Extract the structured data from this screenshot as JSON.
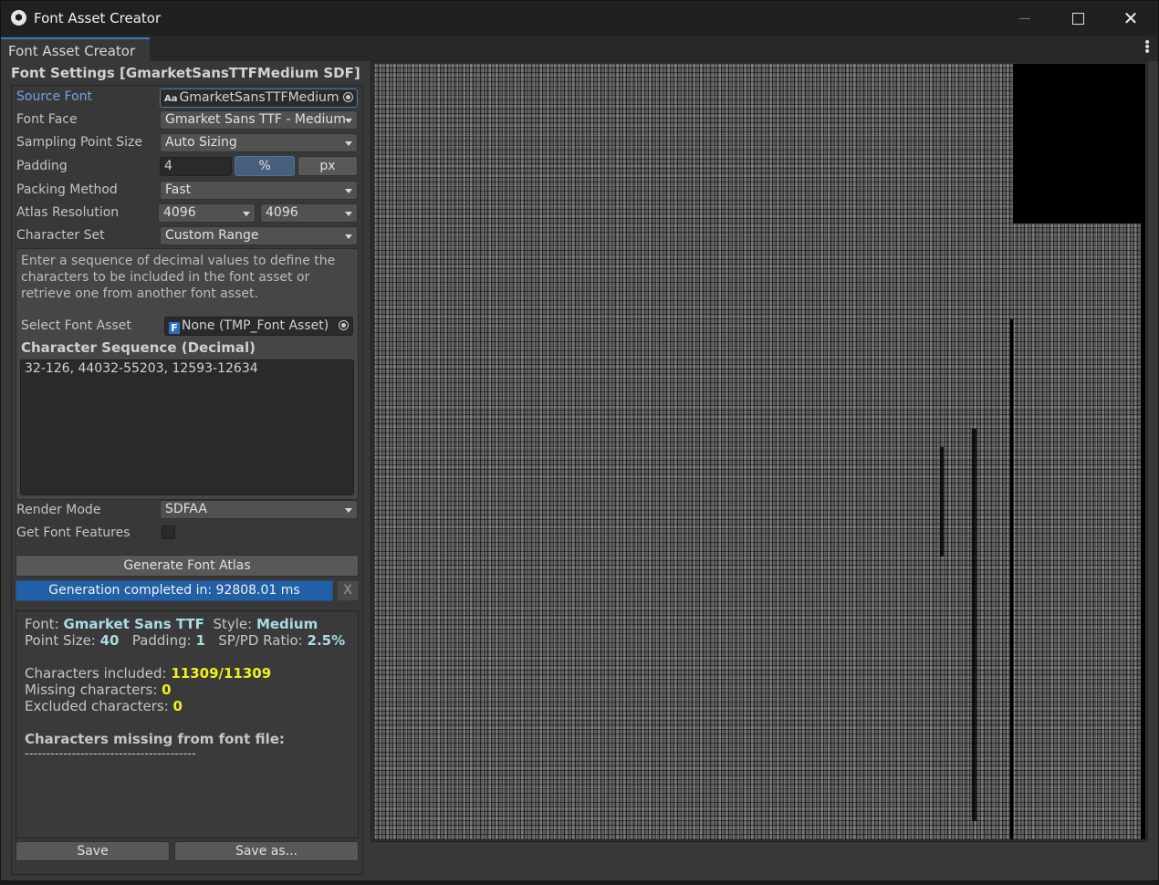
{
  "window": {
    "title": "Font Asset Creator"
  },
  "tabs": [
    {
      "label": "Font Asset Creator"
    }
  ],
  "settings": {
    "section_title": "Font Settings [GmarketSansTTFMedium SDF]",
    "source_font_label": "Source Font",
    "source_font_value": "GmarketSansTTFMedium",
    "source_font_icon_text": "Aa",
    "font_face_label": "Font Face",
    "font_face_value": "Gmarket Sans TTF - Medium",
    "sampling_label": "Sampling Point Size",
    "sampling_value": "Auto Sizing",
    "padding_label": "Padding",
    "padding_value": "4",
    "padding_percent": "%",
    "padding_px": "px",
    "packing_label": "Packing Method",
    "packing_value": "Fast",
    "atlas_label": "Atlas Resolution",
    "atlas_width": "4096",
    "atlas_height": "4096",
    "charset_label": "Character Set",
    "charset_value": "Custom Range",
    "help_text": "Enter a sequence of decimal values to define the characters to be included in the font asset or retrieve one from another font asset.",
    "select_font_asset_label": "Select Font Asset",
    "select_font_asset_value": "None (TMP_Font Asset)",
    "char_seq_label": "Character Sequence (Decimal)",
    "char_seq_value": "32-126, 44032-55203, 12593-12634",
    "render_mode_label": "Render Mode",
    "render_mode_value": "SDFAA",
    "font_features_label": "Get Font Features",
    "font_features_checked": false
  },
  "actions": {
    "generate_label": "Generate Font Atlas",
    "progress_text": "Generation completed in: 92808.01 ms",
    "progress_fraction": 1.0,
    "progress_close": "X",
    "save_label": "Save",
    "save_as_label": "Save as..."
  },
  "info": {
    "font_key": "Font: ",
    "font_val": "Gmarket Sans TTF",
    "style_key": "Style: ",
    "style_val": "Medium",
    "point_key": "Point Size: ",
    "point_val": "40",
    "padding_key": "Padding: ",
    "padding_val": "1",
    "ratio_key": "SP/PD Ratio: ",
    "ratio_val": "2.5%",
    "included_key": "Characters included: ",
    "included_val": "11309/11309",
    "missing_key": "Missing characters: ",
    "missing_val": "0",
    "excluded_key": "Excluded characters: ",
    "excluded_val": "0",
    "missing_header": "Characters missing from font file:",
    "separator": "----------------------------------------"
  },
  "colors": {
    "accent_blue": "#215fa6",
    "highlight_yellow": "#f2f01a",
    "highlight_cyan": "#a9dbe6"
  }
}
